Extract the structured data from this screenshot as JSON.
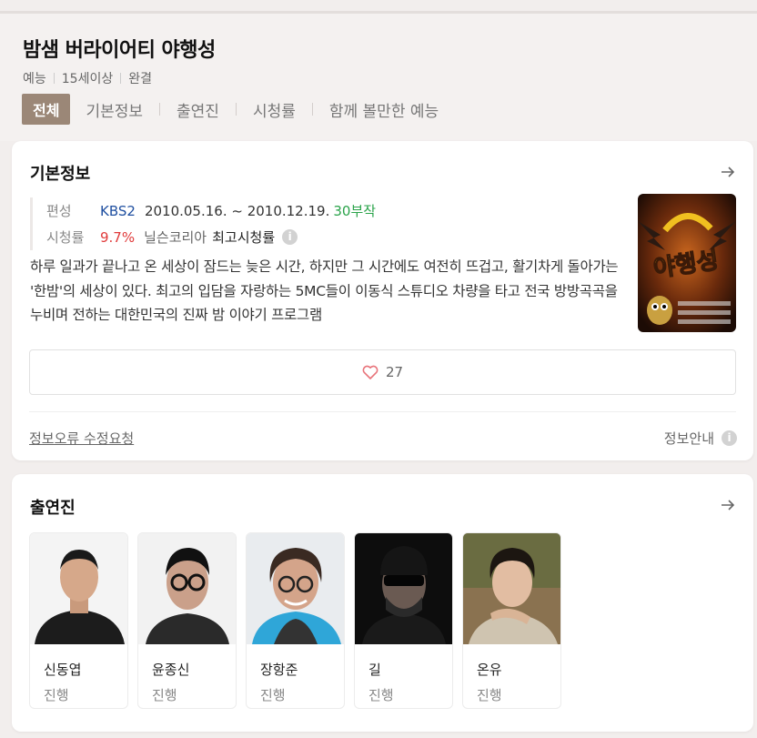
{
  "program": {
    "title": "밤샘 버라이어티 야행성",
    "meta": [
      "예능",
      "15세이상",
      "완결"
    ]
  },
  "tabs": [
    "전체",
    "기본정보",
    "출연진",
    "시청률",
    "함께 볼만한 예능"
  ],
  "basic_info": {
    "section_title": "기본정보",
    "broadcast_label": "편성",
    "channel": "KBS2",
    "dates": "2010.05.16. ~ 2010.12.19.",
    "episodes": "30부작",
    "rating_label": "시청률",
    "rating_value": "9.7%",
    "rating_source": "닐슨코리아",
    "rating_type": "최고시청률",
    "description": "하루 일과가 끝나고 온 세상이 잠드는 늦은 시간, 하지만 그 시간에도 여전히 뜨겁고, 활기차게 돌아가는 '한밤'의 세상이 있다. 최고의 입담을 자랑하는 5MC들이 이동식 스튜디오 차량을 타고 전국 방방곡곡을 누비며 전하는 대한민국의 진짜 밤 이야기 프로그램",
    "poster_logo_text": "야행성",
    "likes": "27",
    "report_link": "정보오류 수정요청",
    "info_guide": "정보안내",
    "info_icon": "i"
  },
  "cast": {
    "section_title": "출연진",
    "members": [
      {
        "name": "신동엽",
        "role": "진행"
      },
      {
        "name": "윤종신",
        "role": "진행"
      },
      {
        "name": "장항준",
        "role": "진행"
      },
      {
        "name": "길",
        "role": "진행"
      },
      {
        "name": "온유",
        "role": "진행"
      }
    ]
  },
  "colors": {
    "active_tab": "#9b8777",
    "channel": "#1f4fa0",
    "episodes": "#2aa34a",
    "rating": "#e03a3a",
    "heart": "#e8737a"
  }
}
